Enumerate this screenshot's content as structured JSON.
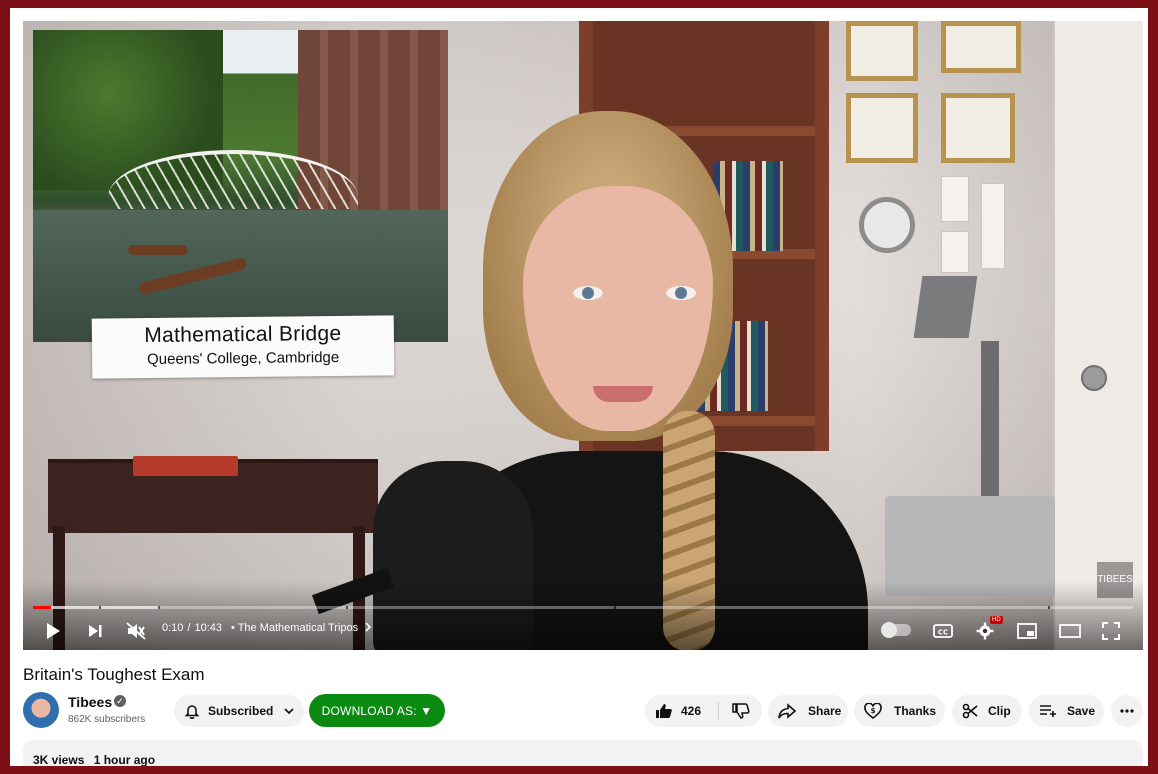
{
  "video": {
    "inset_caption_title": "Mathematical Bridge",
    "inset_caption_subtitle": "Queens' College, Cambridge",
    "watermark": "TIBEES",
    "current_time": "0:10",
    "duration": "10:43",
    "chapter": "• The Mathematical Tripos",
    "progress_fraction": 0.016,
    "buffered_fraction": 0.115,
    "hd_badge": "HD",
    "colors": {
      "progress": "#ff0000",
      "download_button": "#0b8a12"
    }
  },
  "page": {
    "title": "Britain's Toughest Exam",
    "channel_name": "Tibees",
    "subscribers": "862K subscribers",
    "subscribe_label": "Subscribed",
    "download_label": "DOWNLOAD AS: ▼",
    "like_count": "426",
    "share_label": "Share",
    "thanks_label": "Thanks",
    "clip_label": "Clip",
    "save_label": "Save",
    "views": "3K views",
    "posted": "1 hour ago"
  },
  "icons": {
    "play": "play-icon",
    "next": "next-icon",
    "mute": "volume-muted-icon",
    "chevron": "chevron-right-icon",
    "captions": "cc-icon",
    "settings": "gear-icon",
    "miniplayer": "miniplayer-icon",
    "theater": "theater-icon",
    "fullscreen": "fullscreen-icon",
    "bell": "bell-icon",
    "like": "thumbs-up-icon",
    "dislike": "thumbs-down-icon",
    "share": "share-icon",
    "thanks": "thanks-heart-icon",
    "clip": "scissors-icon",
    "save": "save-playlist-icon",
    "more": "more-icon"
  }
}
